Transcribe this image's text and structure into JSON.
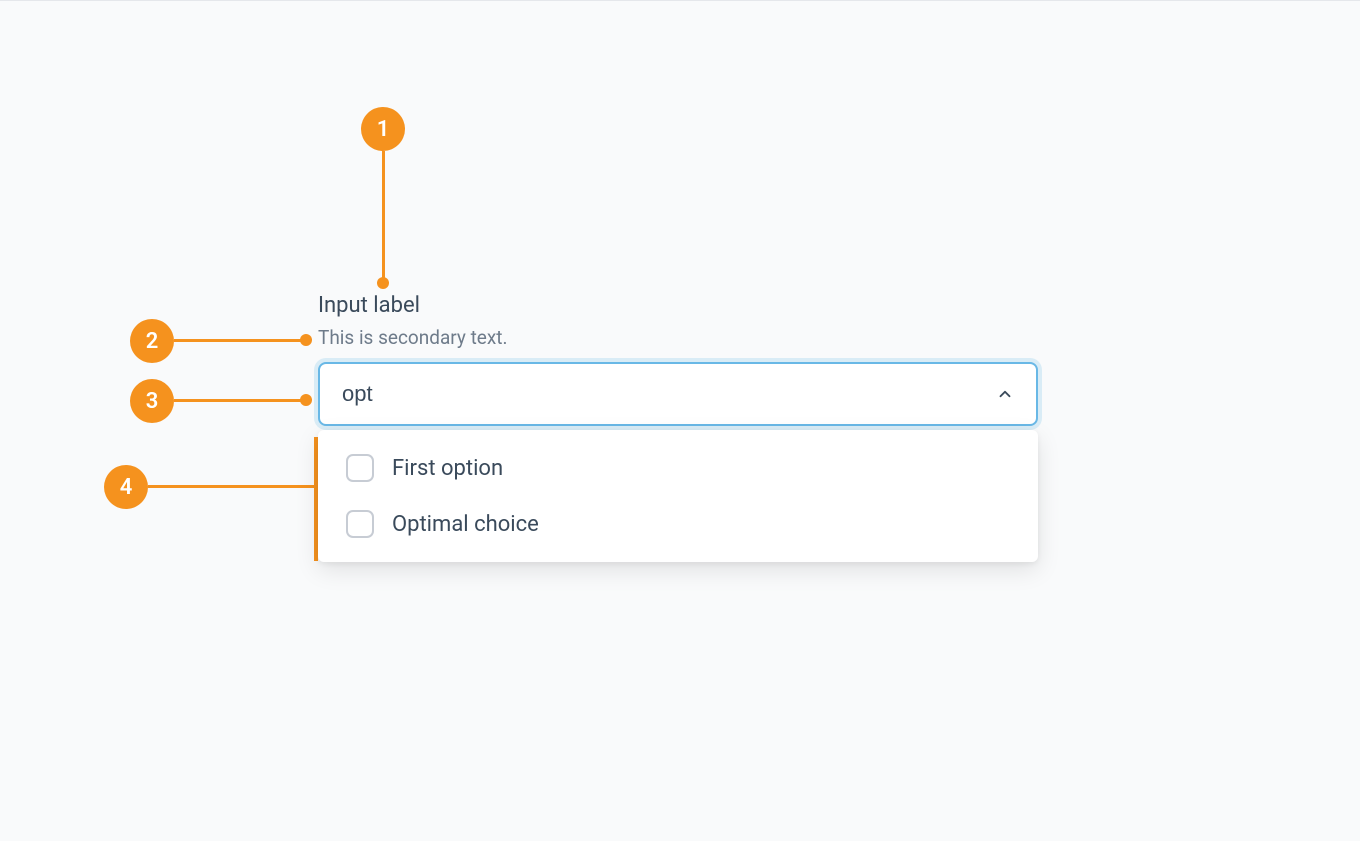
{
  "field": {
    "label": "Input label",
    "secondary": "This is secondary text.",
    "value": "opt",
    "options": [
      {
        "label": "First option"
      },
      {
        "label": "Optimal choice"
      }
    ]
  },
  "annotations": {
    "1": "1",
    "2": "2",
    "3": "3",
    "4": "4"
  },
  "colors": {
    "accent": "#f5921e",
    "focus_ring": "#69b8e6"
  }
}
